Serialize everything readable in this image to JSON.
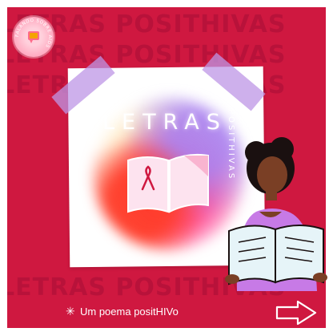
{
  "post": {
    "background_text": "LETRAS POSITHIVAS",
    "logo": {
      "ring_text": "FALANDO SOBRE AIDS"
    },
    "title": "LETRAS",
    "subtitle": "POSITHIVAS",
    "caption": "Um poema positHIVo",
    "icons": {
      "caption_star": "asterisk-icon",
      "next": "arrow-right-icon",
      "ribbon": "awareness-ribbon-icon"
    },
    "colors": {
      "background": "#cf1840",
      "accent_purple": "#c9a0ee",
      "text": "#ffffff"
    }
  }
}
